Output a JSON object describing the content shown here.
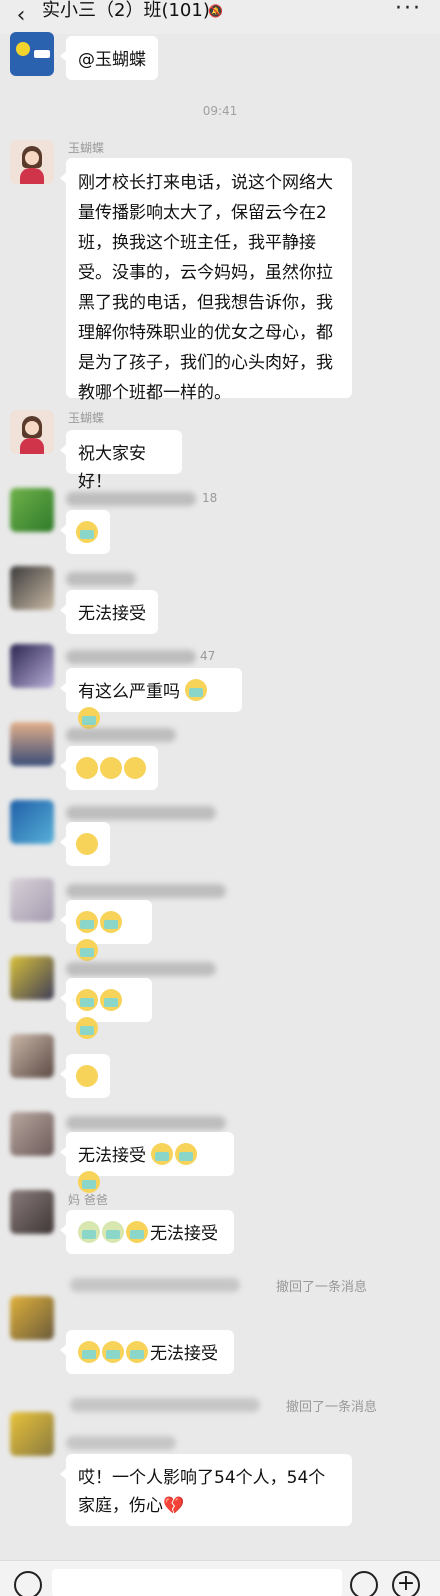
{
  "header": {
    "title": "实小三（2）班(101)",
    "back_icon": "chevron-left-icon",
    "mute_icon": "bell-off-icon",
    "more_icon": "more-dots-icon"
  },
  "timestamp": "09:41",
  "messages": [
    {
      "sender": "",
      "text": "@玉蝴蝶"
    },
    {
      "sender": "玉蝴蝶",
      "text": "刚才校长打来电话，说这个网络大量传播影响太大了，保留云今在2班，换我这个班主任，我平静接受。没事的，云今妈妈，虽然你拉黑了我的电话，但我想告诉你，我理解你特殊职业的优女之母心，都是为了孩子，我们的心头肉好，我教哪个班都一样的。"
    },
    {
      "sender": "玉蝴蝶",
      "text": "祝大家安好！"
    },
    {
      "sender": "18",
      "text": ""
    },
    {
      "sender": "",
      "text": "无法接受"
    },
    {
      "sender": "47",
      "text": "有这么严重吗"
    },
    {
      "sender": "",
      "text": ""
    },
    {
      "sender": "",
      "text": ""
    },
    {
      "sender": "",
      "text": ""
    },
    {
      "sender": "",
      "text": ""
    },
    {
      "sender": "",
      "text": ""
    },
    {
      "sender": "",
      "text": "无法接受"
    },
    {
      "sender": "妈 爸爸",
      "text": "无法接受"
    },
    {
      "sender": "",
      "text": "无法接受"
    },
    {
      "sender": "",
      "text": "哎！一个人影响了54个人，54个家庭，伤心"
    }
  ],
  "system": {
    "recall_1": "撤回了一条消息",
    "recall_2": "撤回了一条消息"
  },
  "input_bar": {
    "voice_icon": "voice-icon",
    "emoji_icon": "smile-icon",
    "plus_icon": "plus-icon"
  }
}
